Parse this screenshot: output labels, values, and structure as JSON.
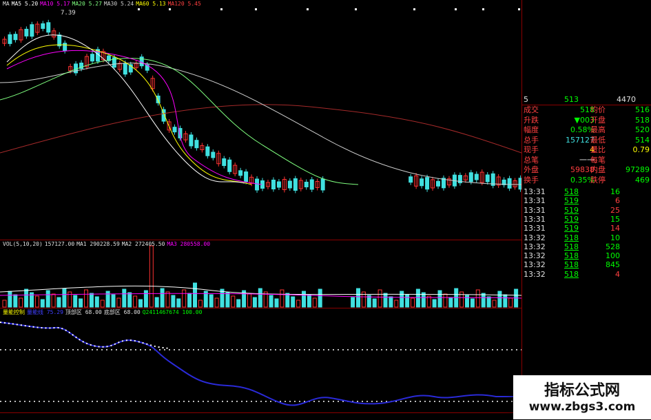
{
  "colors": {
    "up": "#ff3333",
    "down": "#40e0e0",
    "ma5": "#ffffff",
    "ma10": "#ffff00",
    "ma20": "#ff00ff",
    "ma30": "#7fff7f",
    "ma60": "#d0d0d0",
    "ma120": "#a52a2a",
    "line_blue": "#2222ee",
    "dots": "#ffffff",
    "label_white": "#e0e0e0",
    "label_green": "#00ff00",
    "label_red": "#ff4040",
    "label_yellow": "#ffff00"
  },
  "kline": {
    "legend": [
      {
        "text": "MA",
        "color": "#e0e0e0"
      },
      {
        "text": "MA5 5.20",
        "color": "#ffffff"
      },
      {
        "text": "MA10 5.17",
        "color": "#ff00ff"
      },
      {
        "text": "MA20 5.27",
        "color": "#7fff7f"
      },
      {
        "text": "MA30 5.24",
        "color": "#d0d0d0"
      },
      {
        "text": "MA60 5.13",
        "color": "#ffff00"
      },
      {
        "text": "MA120 5.45",
        "color": "#ff4040"
      }
    ],
    "high_label": "7.39"
  },
  "volume": {
    "legend": [
      {
        "text": "VOL(5,10,20)",
        "color": "#e0e0e0"
      },
      {
        "text": "157127.00",
        "color": "#e0e0e0"
      },
      {
        "text": "MA1 290228.59",
        "color": "#e0e0e0"
      },
      {
        "text": "MA2 272405.50",
        "color": "#e0e0e0"
      },
      {
        "text": "MA3 280558.00",
        "color": "#ff00ff"
      }
    ]
  },
  "indicator": {
    "legend": [
      {
        "text": "量能控制",
        "color": "#ffff00"
      },
      {
        "text": "量能线 75.29",
        "color": "#4040ff"
      },
      {
        "text": "顶部区 68.00",
        "color": "#e0e0e0"
      },
      {
        "text": "底部区 68.00",
        "color": "#e0e0e0"
      },
      {
        "text": "Q2411467674 100.00",
        "color": "#00ff00"
      }
    ]
  },
  "quote": {
    "header": {
      "col1": "5",
      "col2": "513",
      "col3": "4470"
    },
    "rows": [
      {
        "l1": "成交",
        "v1": "518",
        "l2": "均价",
        "v2": "516",
        "c1": "#00ff00",
        "c2": "#00ff00"
      },
      {
        "l1": "升跌",
        "v1": "▼003",
        "l2": "开盘",
        "v2": "518",
        "c1": "#00ff00",
        "c2": "#00ff00"
      },
      {
        "l1": "幅度",
        "v1": "0.58%",
        "l2": "最高",
        "v2": "520",
        "c1": "#00ff00",
        "c2": "#00ff00"
      },
      {
        "l1": "总手",
        "v1": "157127",
        "l2": "最低",
        "v2": "514",
        "c1": "#40e0e0",
        "c2": "#00ff00"
      },
      {
        "l1": "现手",
        "v1": "4",
        "l2": "量比",
        "v2": "0.79",
        "c1": "#ffff00",
        "c2": "#ffff00"
      },
      {
        "l1": "总笔",
        "v1": "一一",
        "l2": "每笔",
        "v2": "",
        "c1": "#e0e0e0",
        "c2": "#e0e0e0"
      },
      {
        "l1": "外盘",
        "v1": "59838",
        "l2": "内盘",
        "v2": "97289",
        "c1": "#ff4040",
        "c2": "#00ff00"
      },
      {
        "l1": "换手",
        "v1": "0.35%",
        "l2": "跌停",
        "v2": "469",
        "c1": "#00ff00",
        "c2": "#00ff00"
      }
    ],
    "ticks": [
      {
        "time": "13:31",
        "price": "518",
        "vol": "16",
        "vc": "#00ff00"
      },
      {
        "time": "13:31",
        "price": "519",
        "vol": "6",
        "vc": "#ff4040"
      },
      {
        "time": "13:31",
        "price": "519",
        "vol": "25",
        "vc": "#ff4040"
      },
      {
        "time": "13:31",
        "price": "519",
        "vol": "15",
        "vc": "#00ff00"
      },
      {
        "time": "13:31",
        "price": "519",
        "vol": "14",
        "vc": "#ff4040"
      },
      {
        "time": "13:32",
        "price": "518",
        "vol": "10",
        "vc": "#00ff00"
      },
      {
        "time": "13:32",
        "price": "518",
        "vol": "528",
        "vc": "#00ff00"
      },
      {
        "time": "13:32",
        "price": "518",
        "vol": "100",
        "vc": "#00ff00"
      },
      {
        "time": "13:32",
        "price": "518",
        "vol": "845",
        "vc": "#00ff00"
      },
      {
        "time": "13:32",
        "price": "518",
        "vol": "4",
        "vc": "#ff4040"
      }
    ]
  },
  "watermark": {
    "title": "指标公式网",
    "url": "www.zbgs3.com"
  }
}
